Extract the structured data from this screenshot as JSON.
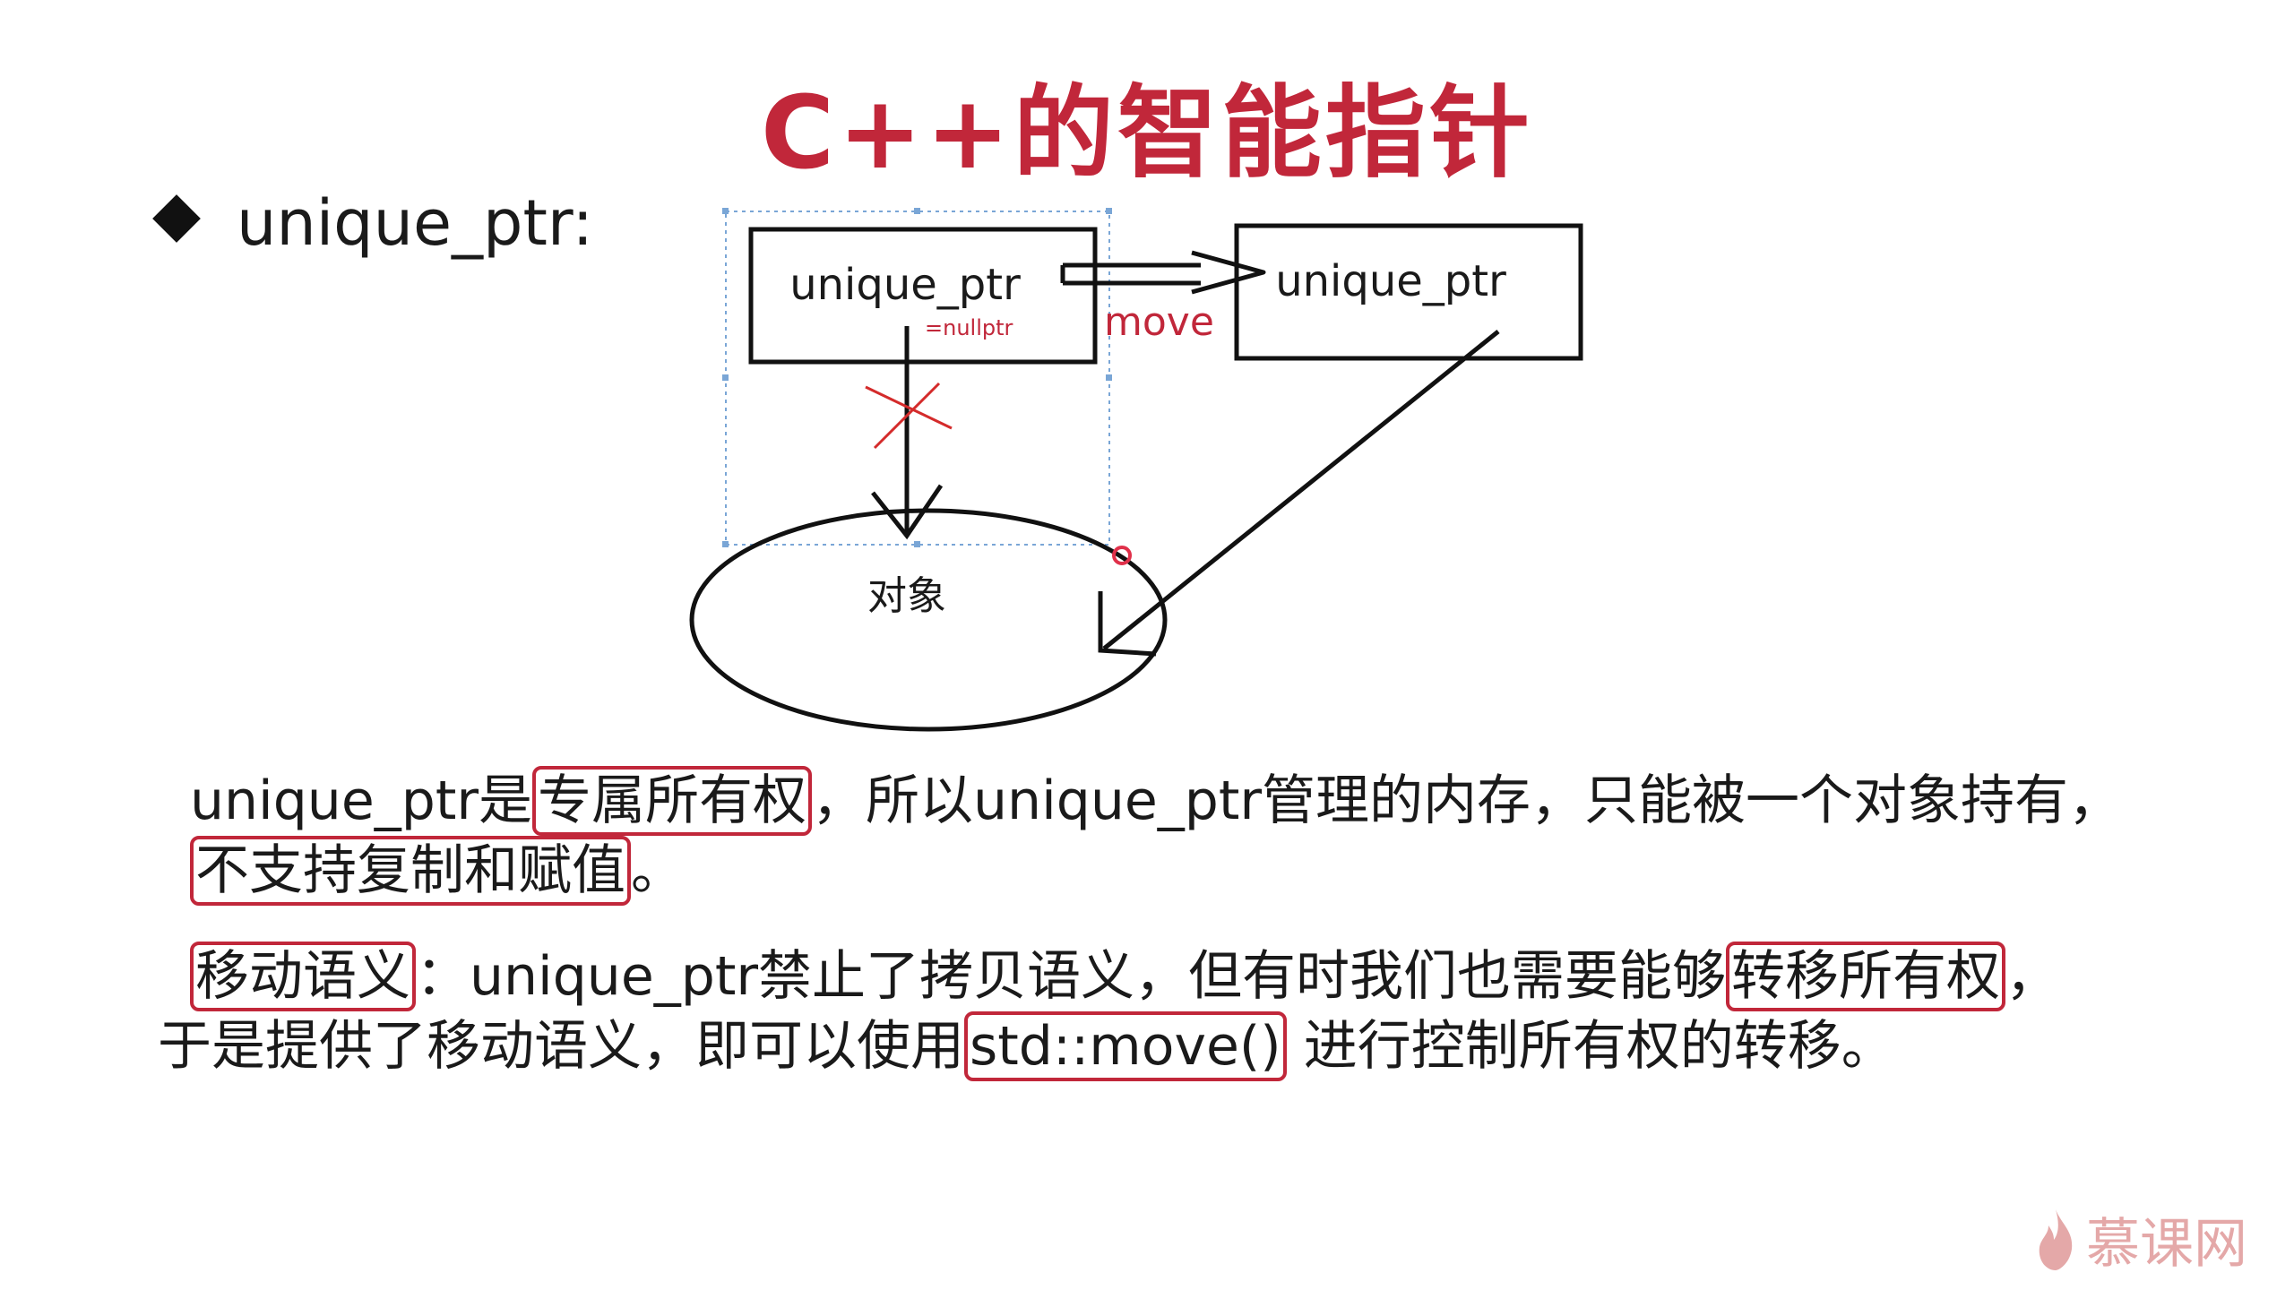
{
  "title": "C++的智能指针",
  "bullet_label": "unique_ptr:",
  "diagram": {
    "box_left_label": "unique_ptr",
    "box_left_note": "=nullptr",
    "box_right_label": "unique_ptr",
    "move_label": "move",
    "object_label": "对象"
  },
  "paragraph1": {
    "line1_pre": "unique_ptr是",
    "line1_hl": "专属所有权",
    "line1_post": "，所以unique_ptr管理的内存，只能被一个对象持有，",
    "line2_hl": "不支持复制和赋值",
    "line2_post": "。"
  },
  "paragraph2": {
    "line1_hl1": "移动语义",
    "line1_mid": "：unique_ptr禁止了拷贝语义，但有时我们也需要能够",
    "line1_hl2": "转移所有权",
    "line1_post": "，",
    "line2_pre": "于是提供了移动语义，即可以使用",
    "line2_hl": "std::move()",
    "line2_post": " 进行控制所有权的转移。"
  },
  "watermark": "慕课网",
  "colors": {
    "accent": "#c1273a",
    "text": "#1a1a1a",
    "watermark": "#e4a8a8"
  }
}
